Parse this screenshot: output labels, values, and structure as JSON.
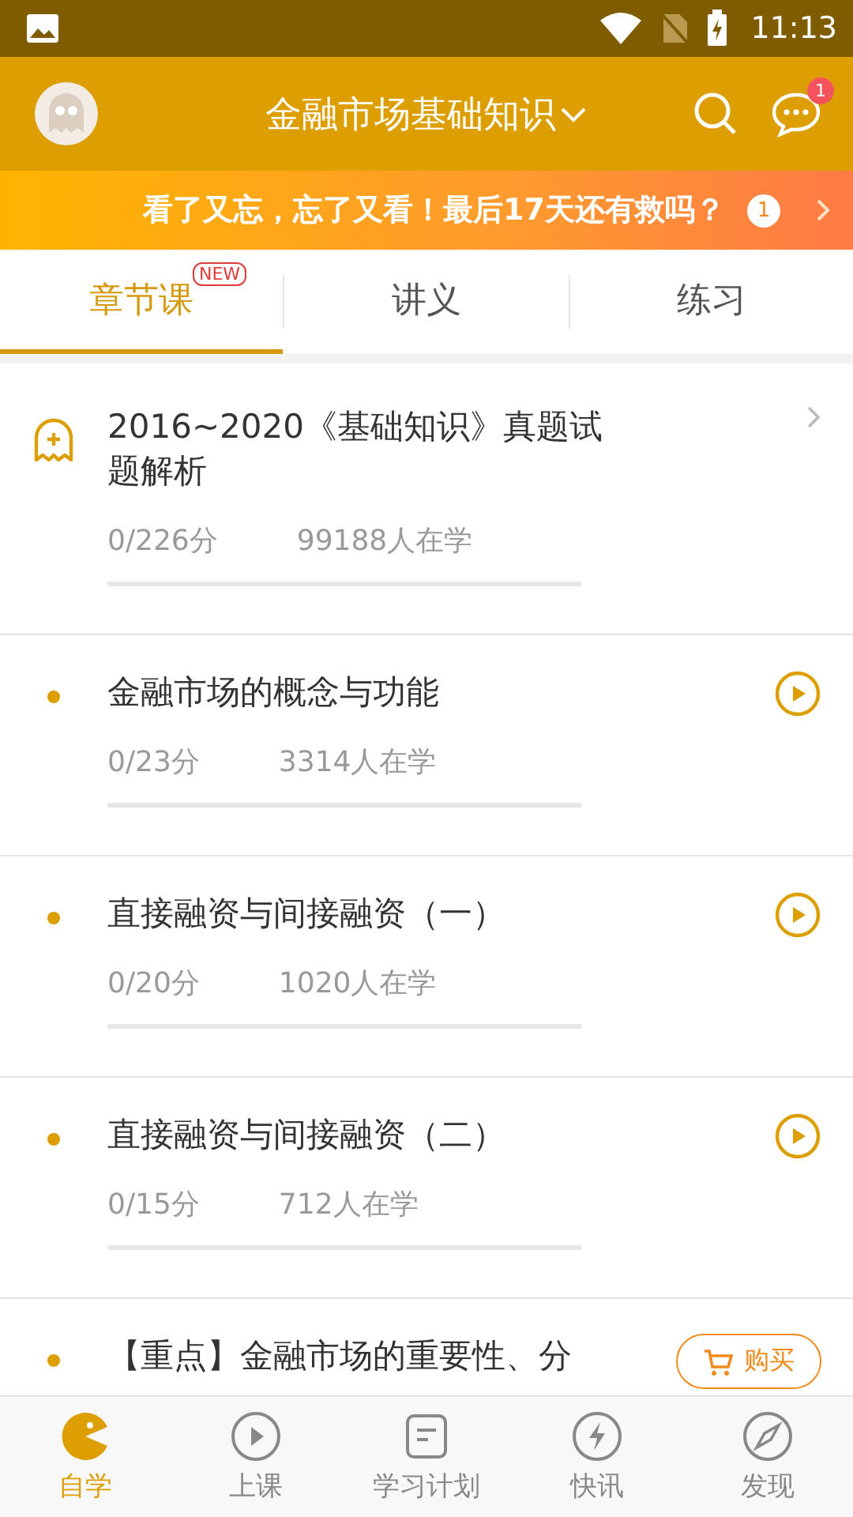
{
  "status_bar": {
    "time": "11:13"
  },
  "header": {
    "title": "金融市场基础知识",
    "badge": "1"
  },
  "banner": {
    "text": "看了又忘，忘了又看！最后17天还有救吗？",
    "count": "1"
  },
  "tabs": [
    {
      "label": "章节课",
      "selected": true,
      "badge": "NEW"
    },
    {
      "label": "讲义",
      "selected": false
    },
    {
      "label": "练习",
      "selected": false
    }
  ],
  "lessons": [
    {
      "kind": "chapter",
      "title": "2016~2020《基础知识》真题试题解析",
      "score": "0/226分",
      "learners": "99188人在学",
      "level": 0
    },
    {
      "kind": "video",
      "title": "金融市场的概念与功能",
      "score": "0/23分",
      "learners": "3314人在学",
      "level": 0
    },
    {
      "kind": "video",
      "title": "直接融资与间接融资（一）",
      "score": "0/20分",
      "learners": "1020人在学",
      "level": 0
    },
    {
      "kind": "video",
      "title": "直接融资与间接融资（二）",
      "score": "0/15分",
      "learners": "712人在学",
      "level": 0
    },
    {
      "kind": "paid",
      "title": "【重点】金融市场的重要性、分",
      "button": "购买"
    }
  ],
  "bottom_nav": [
    {
      "label": "自学",
      "selected": true
    },
    {
      "label": "上课",
      "selected": false
    },
    {
      "label": "学习计划",
      "selected": false
    },
    {
      "label": "快讯",
      "selected": false
    },
    {
      "label": "发现",
      "selected": false
    }
  ]
}
